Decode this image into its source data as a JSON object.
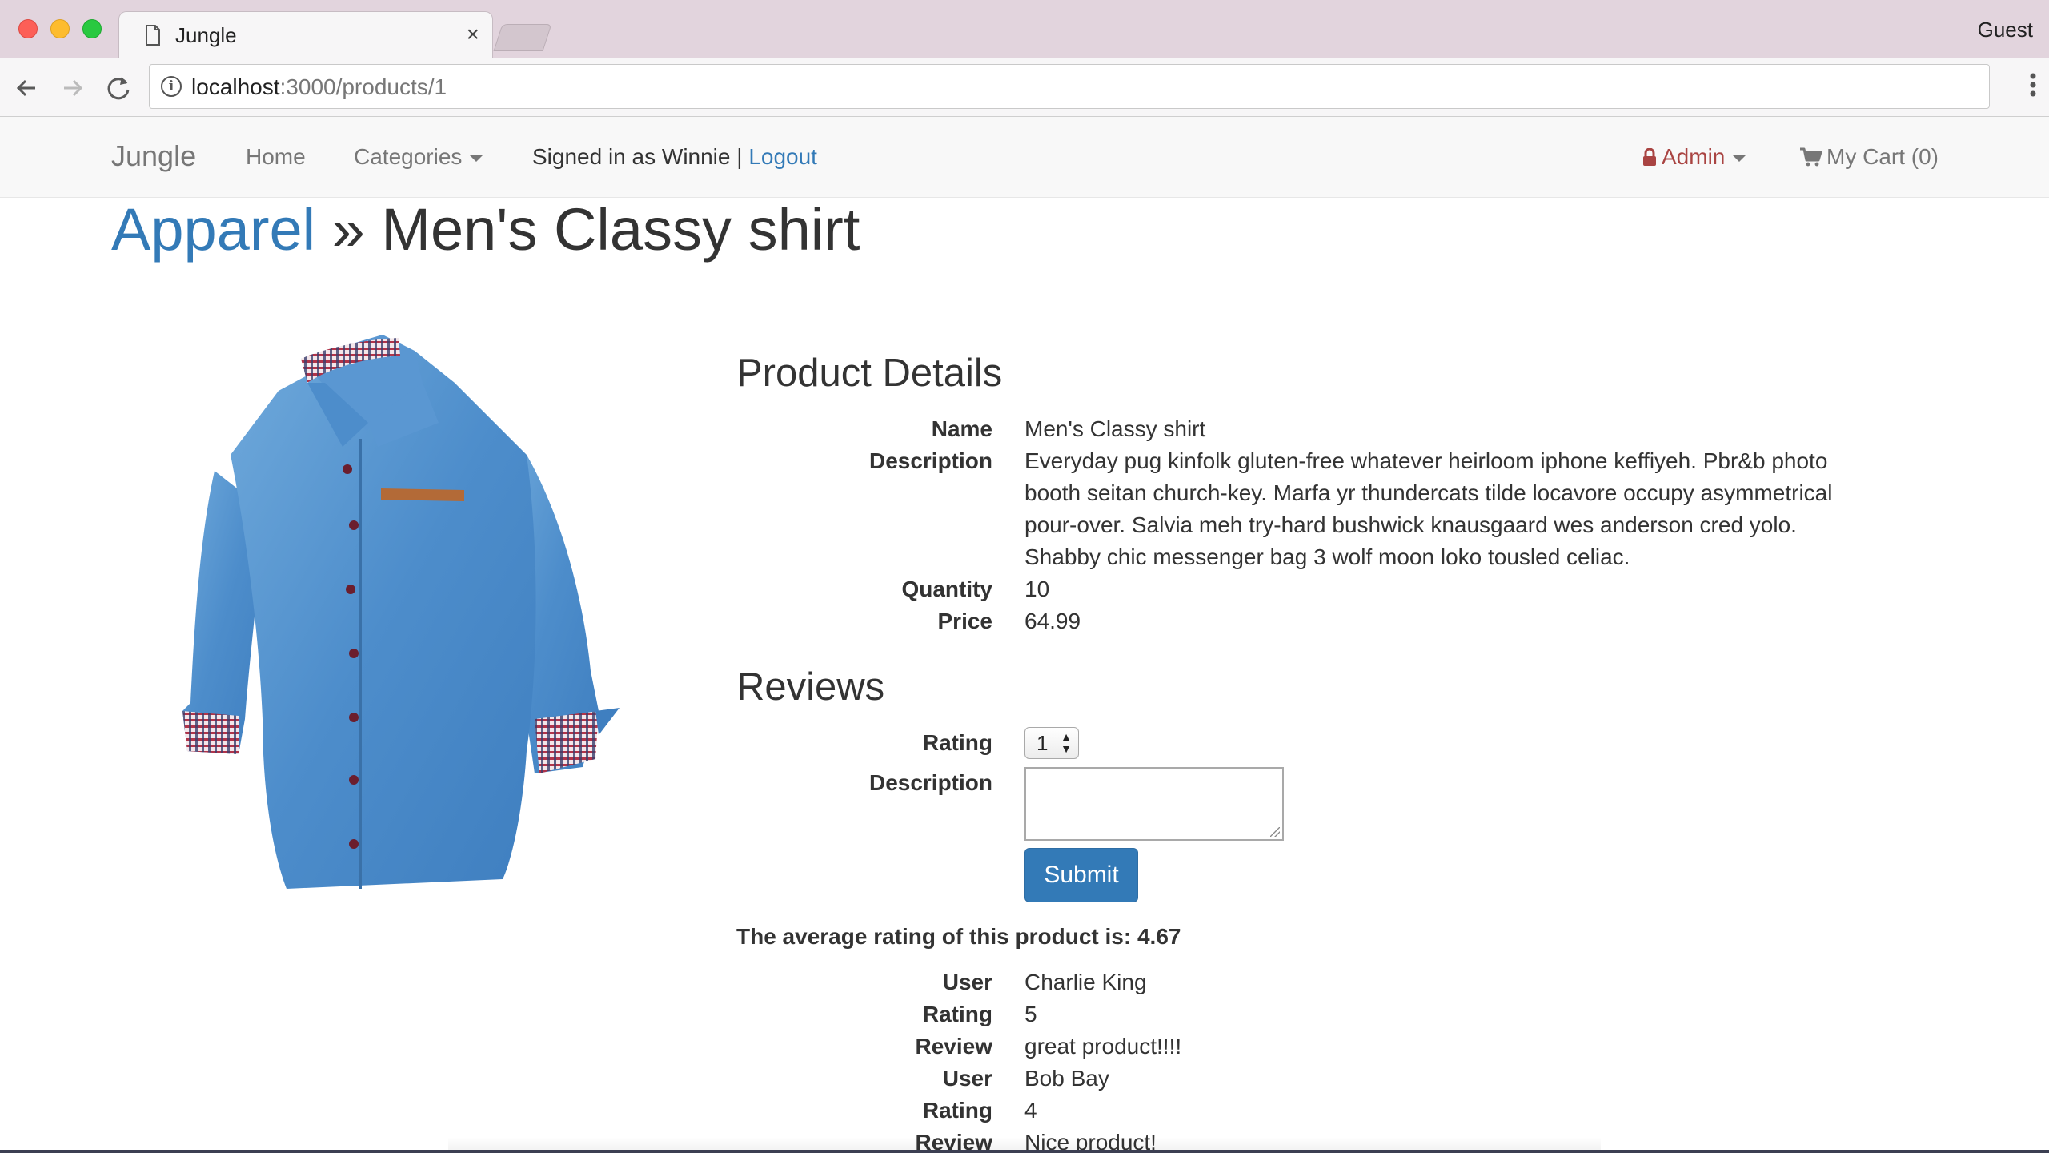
{
  "browser": {
    "tab_title": "Jungle",
    "tab_close": "×",
    "profile": "Guest",
    "url_host": "localhost",
    "url_path": ":3000/products/1"
  },
  "navbar": {
    "brand": "Jungle",
    "home": "Home",
    "categories": "Categories",
    "signed_in_text": "Signed in as Winnie |",
    "logout": "Logout",
    "admin": "Admin",
    "cart": "My Cart (0)"
  },
  "header": {
    "category": "Apparel",
    "separator": " » ",
    "product": "Men's Classy shirt"
  },
  "product_details": {
    "title": "Product Details",
    "name_label": "Name",
    "name": "Men's Classy shirt",
    "description_label": "Description",
    "description": "Everyday pug kinfolk gluten-free whatever heirloom iphone keffiyeh. Pbr&b photo booth seitan church-key. Marfa yr thundercats tilde locavore occupy asymmetrical pour-over. Salvia meh try-hard bushwick knausgaard wes anderson cred yolo. Shabby chic messenger bag 3 wolf moon loko tousled celiac.",
    "quantity_label": "Quantity",
    "quantity": "10",
    "price_label": "Price",
    "price": "64.99"
  },
  "reviews": {
    "title": "Reviews",
    "rating_label": "Rating",
    "rating_selected": "1",
    "description_label": "Description",
    "submit": "Submit",
    "average_text": "The average rating of this product is: 4.67",
    "items": [
      {
        "user_label": "User",
        "user": "Charlie King",
        "rating_label": "Rating",
        "rating": "5",
        "review_label": "Review",
        "review": "great product!!!!"
      },
      {
        "user_label": "User",
        "user": "Bob Bay",
        "rating_label": "Rating",
        "rating": "4",
        "review_label": "Review",
        "review": "Nice product!"
      }
    ]
  },
  "icons": {
    "tab": "page-icon",
    "back": "arrow-left-icon",
    "forward": "arrow-right-icon",
    "reload": "reload-icon",
    "info": "info-icon",
    "menu": "vertical-dots-icon",
    "admin": "lock-icon",
    "cart": "shopping-cart-icon"
  },
  "colors": {
    "link": "#337ab7",
    "admin": "#a94442",
    "submit": "#337ab7",
    "navbar_bg": "#f8f8f8",
    "tabstrip_bg": "#e2d4dd"
  }
}
